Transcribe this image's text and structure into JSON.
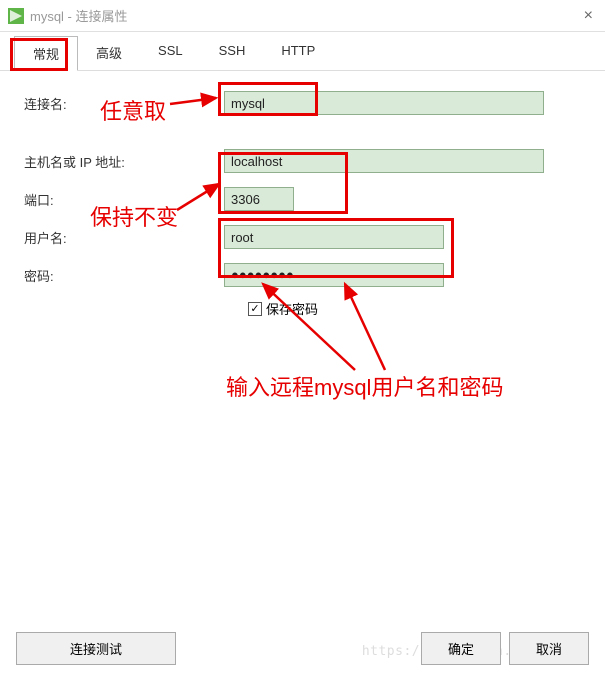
{
  "window": {
    "title": "mysql - 连接属性",
    "close_glyph": "×"
  },
  "tabs": {
    "general": "常规",
    "advanced": "高级",
    "ssl": "SSL",
    "ssh": "SSH",
    "http": "HTTP"
  },
  "labels": {
    "conn_name": "连接名:",
    "host": "主机名或 IP 地址:",
    "port": "端口:",
    "username": "用户名:",
    "password": "密码:",
    "save_password": "保存密码"
  },
  "values": {
    "conn_name": "mysql",
    "host": "localhost",
    "port": "3306",
    "username": "root",
    "password": "●●●●●●●●",
    "save_password_checked": "☑"
  },
  "buttons": {
    "test": "连接测试",
    "ok": "确定",
    "cancel": "取消"
  },
  "annotations": {
    "any_name": "任意取",
    "keep_unchanged": "保持不变",
    "enter_remote": "输入远程mysql用户名和密码"
  },
  "watermark": "https://blog.csdn.net/",
  "colors": {
    "highlight": "#e60000",
    "input_bg": "#d9ead8"
  }
}
